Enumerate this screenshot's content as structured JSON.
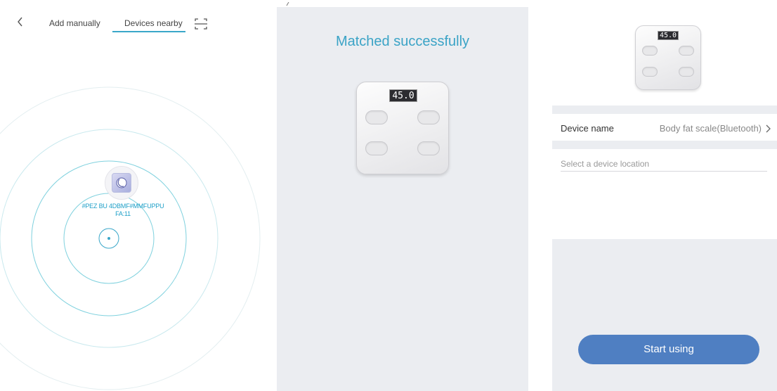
{
  "screen1": {
    "tabs": [
      {
        "label": "Add manually"
      },
      {
        "label": "Devices nearby",
        "active": true
      }
    ],
    "device": {
      "name_line1": "#PEZ BU 4DBMF#MMFUPPU",
      "name_line2": "FA:11"
    },
    "accent_color": "#3aa7c9"
  },
  "screen2": {
    "title": "Matched successfully",
    "scale_display": "45.0",
    "title_color": "#3aa3c6"
  },
  "screen3": {
    "scale_display": "45.0",
    "device_name_label": "Device name",
    "device_name_value": "Body fat scale(Bluetooth)",
    "location_placeholder": "Select a device location",
    "start_button_label": "Start using",
    "button_color": "#4f7fc2"
  }
}
